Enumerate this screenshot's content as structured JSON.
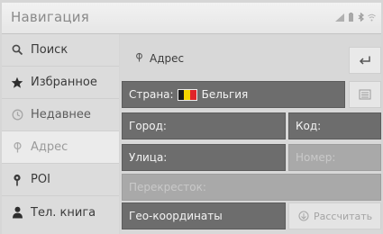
{
  "app": {
    "title": "Навигация"
  },
  "sidebar": {
    "items": [
      {
        "label": "Поиск",
        "icon": "search-icon"
      },
      {
        "label": "Избранное",
        "icon": "star-icon"
      },
      {
        "label": "Недавнее",
        "icon": "clock-icon"
      },
      {
        "label": "Адрес",
        "icon": "address-pin-icon",
        "active": true
      },
      {
        "label": "POI",
        "icon": "poi-pin-icon"
      },
      {
        "label": "Тел. книга",
        "icon": "person-icon"
      }
    ]
  },
  "main": {
    "title": "Адрес",
    "country_label": "Страна:",
    "country_value": "Бельгия",
    "flag_colors": [
      "#1a1a1a",
      "#f3d400",
      "#e0242a"
    ],
    "city_label": "Город:",
    "code_label": "Код:",
    "street_label": "Улица:",
    "number_label": "Номер:",
    "crossing_label": "Перекресток:",
    "geo_label": "Гео-координаты",
    "calc_label": "Рассчитать"
  }
}
